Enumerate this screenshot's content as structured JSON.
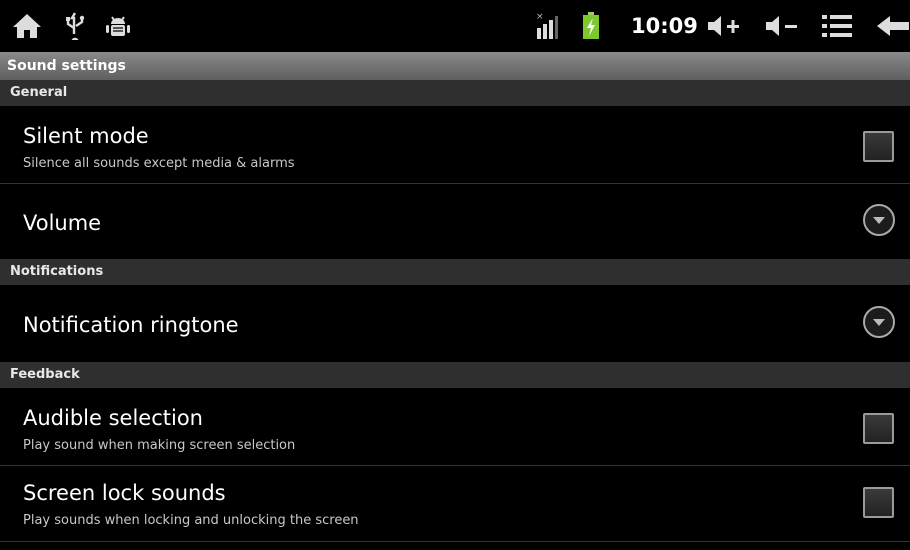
{
  "status_bar": {
    "left_icons": [
      "home-icon",
      "usb-icon",
      "android-debug-icon"
    ],
    "time": "10:09",
    "right_icons": [
      "signal-icon",
      "battery-charging-icon",
      "volume-up-icon",
      "volume-down-icon",
      "menu-icon",
      "back-icon"
    ]
  },
  "title_bar": {
    "title": "Sound settings"
  },
  "sections": {
    "general": "General",
    "notifications": "Notifications",
    "feedback": "Feedback"
  },
  "items": {
    "silent_mode": {
      "title": "Silent mode",
      "summary": "Silence all sounds except media & alarms",
      "checked": false
    },
    "volume": {
      "title": "Volume"
    },
    "notification_ringtone": {
      "title": "Notification ringtone"
    },
    "audible_selection": {
      "title": "Audible selection",
      "summary": "Play sound when making screen selection",
      "checked": false
    },
    "screen_lock_sounds": {
      "title": "Screen lock sounds",
      "summary": "Play sounds when locking and unlocking the screen",
      "checked": false
    }
  },
  "colors": {
    "background": "#000000",
    "section_header": "#2f2f2f",
    "title_bar": "#7a7a7a",
    "battery": "#7cc82e"
  }
}
